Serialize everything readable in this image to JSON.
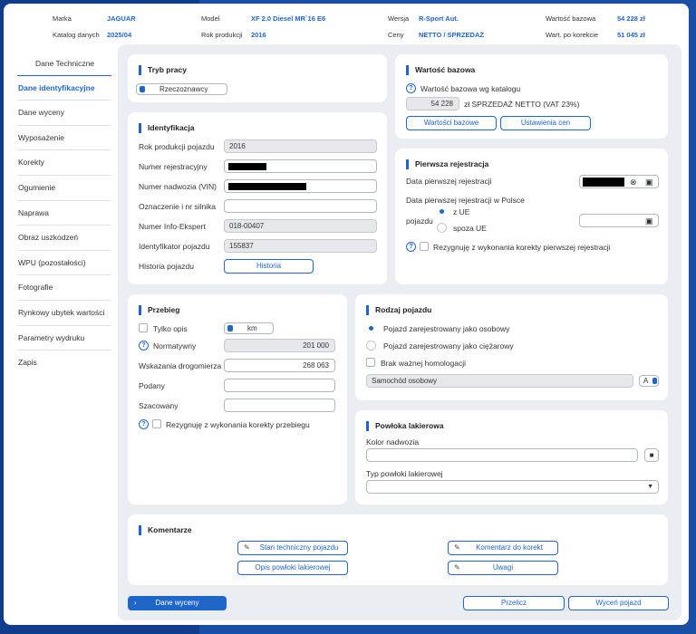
{
  "header": {
    "marka_label": "Marka",
    "marka": "JAGUAR",
    "katalog_label": "Katalog danych",
    "katalog": "2025/04",
    "model_label": "Model",
    "model": "XF 2.0 Diesel MR`16 E6",
    "rok_label": "Rok produkcji",
    "rok": "2016",
    "wersja_label": "Wersja",
    "wersja": "R-Sport Aut.",
    "ceny_label": "Ceny",
    "ceny": "NETTO / SPRZEDAŻ",
    "wb_label": "Wartość bazowa",
    "wb": "54 228 zł",
    "wk_label": "Wart. po korekcie",
    "wk": "51 045 zł"
  },
  "sidebar": {
    "items": [
      "Dane Techniczne",
      "Dane identyfikacyjne",
      "Dane wyceny",
      "Wyposażenie",
      "Korekty",
      "Ogumienie",
      "Naprawa",
      "Obraz uszkodzeń",
      "WPU (pozostałości)",
      "Fotografie",
      "Rynkowy ubytek wartości",
      "Parametry wydruku",
      "Zapis"
    ]
  },
  "tryb": {
    "title": "Tryb pracy",
    "mode": "Rzeczoznawcy"
  },
  "ident": {
    "title": "Identyfikacja",
    "rok_label": "Rok produkcji pojazdu",
    "rok": "2016",
    "rej_label": "Numer rejestracyjny",
    "vin_label": "Numer nadwozia (VIN)",
    "silnik_label": "Oznaczenie i nr silnika",
    "info_label": "Numer Info-Ekspert",
    "info": "018-00407",
    "idp_label": "Identyfikator pojazdu",
    "idp": "155837",
    "hist_label": "Historia pojazdu",
    "hist_btn": "Historia"
  },
  "wartosc": {
    "title": "Wartość bazowa",
    "caption": "Wartość bazowa wg katalogu",
    "value": "54 228",
    "suffix": "zł SPRZEDAŻ NETTO (VAT 23%)",
    "btn1": "Wartości bazowe",
    "btn2": "Ustawienia cen"
  },
  "rejestracja": {
    "title": "Pierwsza rejestracja",
    "data_label": "Data pierwszej rejestracji",
    "polska_label": "Data pierwszej rejestracji w Polsce",
    "pojazdu": "pojazdu",
    "opt1": "z UE",
    "opt2": "spoza UE",
    "rezygnuje": "Rezygnuję z wykonania korekty pierwszej rejestracji"
  },
  "przebieg": {
    "title": "Przebieg",
    "tylko": "Tylko opis",
    "unit": "km",
    "norm_label": "Normatywny",
    "norm": "201 000",
    "wsk_label": "Wskazania drogomierza",
    "wsk": "268 063",
    "podany_label": "Podany",
    "szac_label": "Szacowany",
    "rezygnuje": "Rezygnuję z wykonania korekty przebiegu"
  },
  "rodzaj": {
    "title": "Rodzaj pojazdu",
    "opt1": "Pojazd zarejestrowany jako osobowy",
    "opt2": "Pojazd zarejestrowany jako ciężarowy",
    "brak": "Brak ważnej homologacji",
    "typ": "Samochód osobowy",
    "code": "A"
  },
  "powloka": {
    "title": "Powłoka lakierowa",
    "kolor_label": "Kolor nadwozia",
    "typ_label": "Typ powłoki lakierowej"
  },
  "komentarze": {
    "title": "Komentarze",
    "b1": "Stan techniczny pojazdu",
    "b2": "Opis powłoki lakierowej",
    "b3": "Komentarz do korekt",
    "b4": "Uwagi"
  },
  "footer": {
    "dane": "Dane wyceny",
    "przelicz": "Przelicz",
    "wycen": "Wyceń pojazd"
  }
}
